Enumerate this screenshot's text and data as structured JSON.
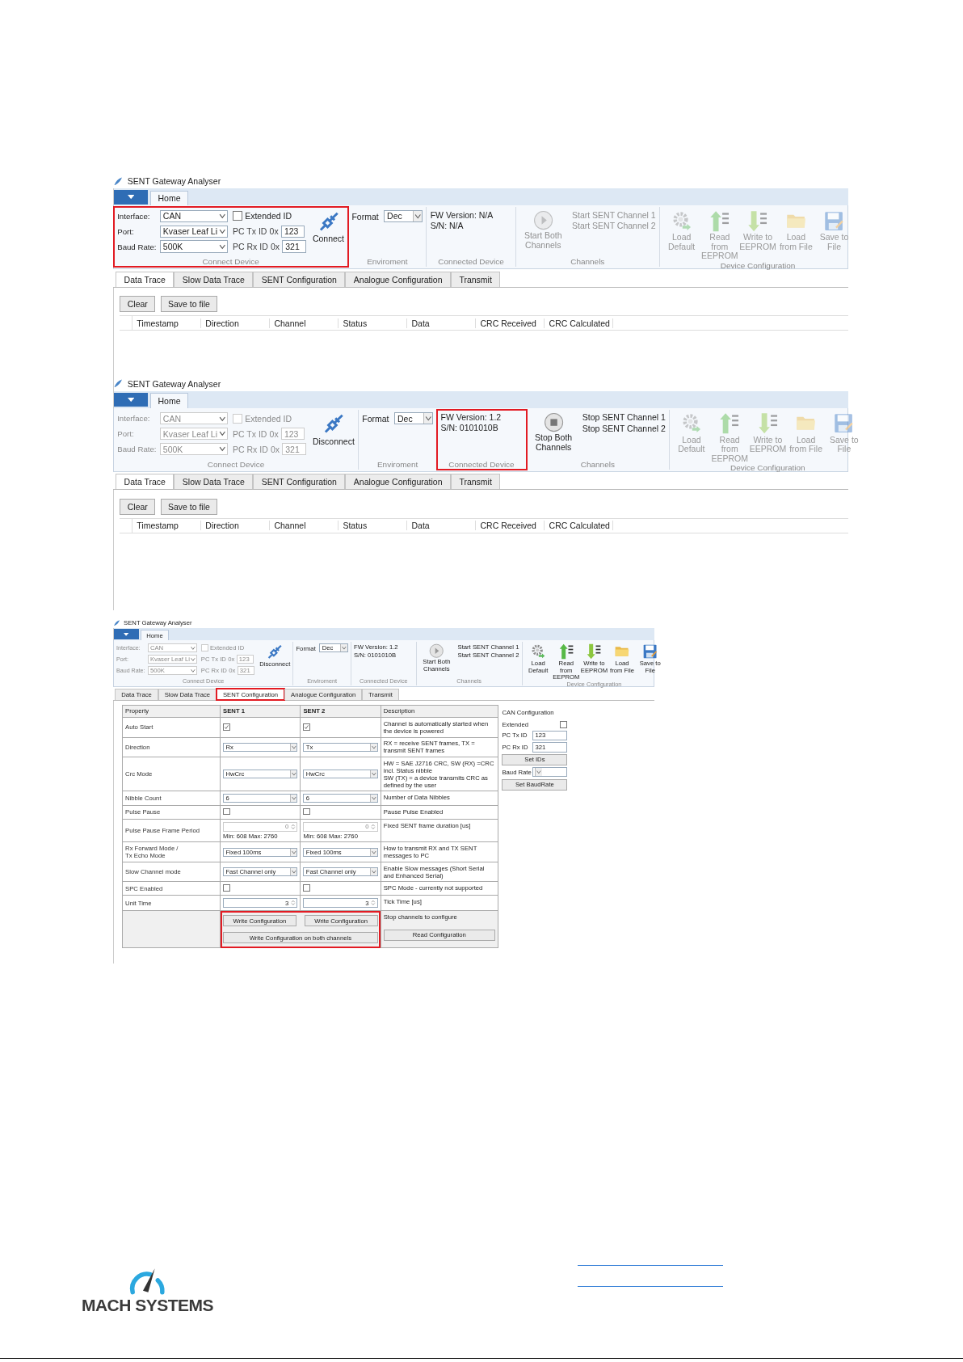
{
  "shots": [
    {
      "title": "SENT Gateway Analyser",
      "app_tab": "Home",
      "connect": {
        "highlighted": true,
        "disabled": false,
        "caption": "Connect Device",
        "button": "Connect",
        "fields": [
          {
            "label": "Interface:",
            "value": "CAN"
          },
          {
            "label": "Port:",
            "value": "Kvaser Leaf Li"
          },
          {
            "label": "Baud Rate:",
            "value": "500K"
          }
        ],
        "extended": {
          "label": "Extended ID",
          "checked": false
        },
        "ids": [
          {
            "label": "PC Tx ID",
            "prefix": "0x",
            "value": "123"
          },
          {
            "label": "PC Rx ID",
            "prefix": "0x",
            "value": "321"
          }
        ]
      },
      "environment": {
        "label": "Format",
        "value": "Dec",
        "caption": "Enviroment"
      },
      "device": {
        "highlighted": false,
        "lines": [
          "FW Version: N/A",
          "S/N: N/A"
        ],
        "caption": "Connected Device"
      },
      "channels": {
        "running": false,
        "disabled": true,
        "button": "Start Both Channels",
        "items": [
          "Start SENT Channel 1",
          "Start SENT Channel 2"
        ],
        "caption": "Channels"
      },
      "config": {
        "disabled": true,
        "caption": "Device Configuration",
        "buttons": [
          {
            "kind": "gear",
            "label": "Load Default"
          },
          {
            "kind": "upload",
            "label": "Read from EEPROM"
          },
          {
            "kind": "download",
            "label": "Write to EEPROM"
          },
          {
            "kind": "folder",
            "label": "Load from File"
          },
          {
            "kind": "save",
            "label": "Save to File"
          }
        ]
      },
      "tabs": [
        {
          "label": "Data Trace",
          "selected": true,
          "highlighted": false
        },
        {
          "label": "Slow Data Trace",
          "selected": false,
          "highlighted": false
        },
        {
          "label": "SENT Configuration",
          "selected": false,
          "highlighted": false
        },
        {
          "label": "Analogue Configuration",
          "selected": false,
          "highlighted": false
        },
        {
          "label": "Transmit",
          "selected": false,
          "highlighted": false
        }
      ],
      "body": {
        "kind": "trace",
        "buttons": [
          "Clear",
          "Save to file"
        ],
        "columns": [
          "Timestamp",
          "Direction",
          "Channel",
          "Status",
          "Data",
          "CRC Received",
          "CRC Calculated"
        ]
      }
    },
    {
      "title": "SENT Gateway Analyser",
      "app_tab": "Home",
      "connect": {
        "highlighted": false,
        "disabled": true,
        "caption": "Connect Device",
        "button": "Disconnect",
        "fields": [
          {
            "label": "Interface:",
            "value": "CAN"
          },
          {
            "label": "Port:",
            "value": "Kvaser Leaf Li"
          },
          {
            "label": "Baud Rate:",
            "value": "500K"
          }
        ],
        "extended": {
          "label": "Extended ID",
          "checked": false
        },
        "ids": [
          {
            "label": "PC Tx ID",
            "prefix": "0x",
            "value": "123"
          },
          {
            "label": "PC Rx ID",
            "prefix": "0x",
            "value": "321"
          }
        ]
      },
      "environment": {
        "label": "Format",
        "value": "Dec",
        "caption": "Enviroment"
      },
      "device": {
        "highlighted": true,
        "lines": [
          "FW Version: 1.2",
          "S/N: 0101010B"
        ],
        "caption": "Connected Device"
      },
      "channels": {
        "running": true,
        "disabled": false,
        "button": "Stop Both Channels",
        "items": [
          "Stop SENT Channel 1",
          "Stop SENT Channel 2"
        ],
        "caption": "Channels"
      },
      "config": {
        "disabled": true,
        "caption": "Device Configuration",
        "buttons": [
          {
            "kind": "gear",
            "label": "Load Default"
          },
          {
            "kind": "upload",
            "label": "Read from EEPROM"
          },
          {
            "kind": "download",
            "label": "Write to EEPROM"
          },
          {
            "kind": "folder",
            "label": "Load from File"
          },
          {
            "kind": "save",
            "label": "Save to File"
          }
        ]
      },
      "tabs": [
        {
          "label": "Data Trace",
          "selected": true,
          "highlighted": false
        },
        {
          "label": "Slow Data Trace",
          "selected": false,
          "highlighted": false
        },
        {
          "label": "SENT Configuration",
          "selected": false,
          "highlighted": false
        },
        {
          "label": "Analogue Configuration",
          "selected": false,
          "highlighted": false
        },
        {
          "label": "Transmit",
          "selected": false,
          "highlighted": false
        }
      ],
      "body": {
        "kind": "trace",
        "buttons": [
          "Clear",
          "Save to file"
        ],
        "columns": [
          "Timestamp",
          "Direction",
          "Channel",
          "Status",
          "Data",
          "CRC Received",
          "CRC Calculated"
        ]
      }
    },
    {
      "title": "SENT Gateway Analyser",
      "app_tab": "Home",
      "connect": {
        "highlighted": false,
        "disabled": true,
        "caption": "Connect Device",
        "button": "Disconnect",
        "fields": [
          {
            "label": "Interface:",
            "value": "CAN"
          },
          {
            "label": "Port:",
            "value": "Kvaser Leaf Li"
          },
          {
            "label": "Baud Rate:",
            "value": "500K"
          }
        ],
        "extended": {
          "label": "Extended ID",
          "checked": false
        },
        "ids": [
          {
            "label": "PC Tx ID",
            "prefix": "0x",
            "value": "123"
          },
          {
            "label": "PC Rx ID",
            "prefix": "0x",
            "value": "321"
          }
        ]
      },
      "environment": {
        "label": "Format",
        "value": "Dec",
        "caption": "Enviroment"
      },
      "device": {
        "highlighted": false,
        "lines": [
          "FW Version: 1.2",
          "S/N: 0101010B"
        ],
        "caption": "Connected Device"
      },
      "channels": {
        "running": false,
        "disabled": false,
        "button": "Start Both Channels",
        "items": [
          "Start SENT Channel 1",
          "Start SENT Channel 2"
        ],
        "caption": "Channels"
      },
      "config": {
        "disabled": false,
        "caption": "Device Configuration",
        "buttons": [
          {
            "kind": "gear",
            "label": "Load Default"
          },
          {
            "kind": "upload",
            "label": "Read from EEPROM"
          },
          {
            "kind": "download",
            "label": "Write to EEPROM"
          },
          {
            "kind": "folder",
            "label": "Load from File"
          },
          {
            "kind": "save",
            "label": "Save to File"
          }
        ]
      },
      "tabs": [
        {
          "label": "Data Trace",
          "selected": false,
          "highlighted": false
        },
        {
          "label": "Slow Data Trace",
          "selected": false,
          "highlighted": false
        },
        {
          "label": "SENT Configuration",
          "selected": true,
          "highlighted": true
        },
        {
          "label": "Analogue Configuration",
          "selected": false,
          "highlighted": false
        },
        {
          "label": "Transmit",
          "selected": false,
          "highlighted": false
        }
      ],
      "body": {
        "kind": "config",
        "columns": [
          "Property",
          "SENT 1",
          "SENT 2",
          "Description"
        ],
        "rows": [
          {
            "property": "Auto Start",
            "sent_1": {
              "kind": "check",
              "checked": true
            },
            "sent_2": {
              "kind": "check",
              "checked": true
            },
            "description": "Channel is automatically started when the device is powered"
          },
          {
            "property": "Direction",
            "sent_1": {
              "kind": "select",
              "value": "Rx"
            },
            "sent_2": {
              "kind": "select",
              "value": "Tx"
            },
            "description": "RX = receive SENT frames, TX = transmit SENT frames"
          },
          {
            "property": "Crc Mode",
            "sent_1": {
              "kind": "select",
              "value": "HwCrc"
            },
            "sent_2": {
              "kind": "select",
              "value": "HwCrc"
            },
            "description": "HW = SAE J2716 CRC, SW (RX) =CRC incl. Status nibble\nSW (TX) = a device transmits CRC as defined by the user"
          },
          {
            "property": "Nibble Count",
            "sent_1": {
              "kind": "select",
              "value": "6"
            },
            "sent_2": {
              "kind": "select",
              "value": "6"
            },
            "description": "Number of Data Nibbles"
          },
          {
            "property": "Pulse Pause",
            "sent_1": {
              "kind": "check",
              "checked": false
            },
            "sent_2": {
              "kind": "check",
              "checked": false
            },
            "description": "Pause Pulse Enabled"
          },
          {
            "property": "Pulse Pause Frame Period",
            "sent_1": {
              "kind": "spin",
              "value": "0",
              "disabled": true,
              "note": "Min: 608 Max: 2760"
            },
            "sent_2": {
              "kind": "spin",
              "value": "0",
              "disabled": true,
              "note": "Min: 608 Max: 2760"
            },
            "description": "Fixed SENT frame duration [us]"
          },
          {
            "property": "Rx Forward Mode /\nTx Echo Mode",
            "sent_1": {
              "kind": "select",
              "value": "Fixed 100ms"
            },
            "sent_2": {
              "kind": "select",
              "value": "Fixed 100ms"
            },
            "description": "How to transmit RX and TX SENT messages to PC"
          },
          {
            "property": "Slow Channel mode",
            "sent_1": {
              "kind": "select",
              "value": "Fast Channel only"
            },
            "sent_2": {
              "kind": "select",
              "value": "Fast Channel only"
            },
            "description": "Enable Slow messages (Short Serial and Enhanced Serial)"
          },
          {
            "property": "SPC Enabled",
            "sent_1": {
              "kind": "check",
              "checked": false
            },
            "sent_2": {
              "kind": "check",
              "checked": false
            },
            "description": "SPC Mode - currently not supported"
          },
          {
            "property": "Unit Time",
            "sent_1": {
              "kind": "spin",
              "value": "3",
              "disabled": false
            },
            "sent_2": {
              "kind": "spin",
              "value": "3",
              "disabled": false
            },
            "description": "Tick Time [us]"
          }
        ],
        "actions": {
          "highlighted": true,
          "write_1": "Write Configuration",
          "write_2": "Write Configuration",
          "write_both": "Write Configuration on both channels",
          "note": "Stop channels to configure",
          "read": "Read Configuration"
        },
        "can": {
          "title": "CAN Configuration",
          "extended": {
            "label": "Extended",
            "checked": false
          },
          "ids": [
            {
              "label": "PC Tx ID",
              "value": "123"
            },
            {
              "label": "PC Rx ID",
              "value": "321"
            }
          ],
          "set_ids": "Set IDs",
          "baud_label": "Baud Rate",
          "set_baud": "Set BaudRate"
        }
      }
    }
  ],
  "footer": {
    "logo": "MACH SYSTEMS"
  }
}
